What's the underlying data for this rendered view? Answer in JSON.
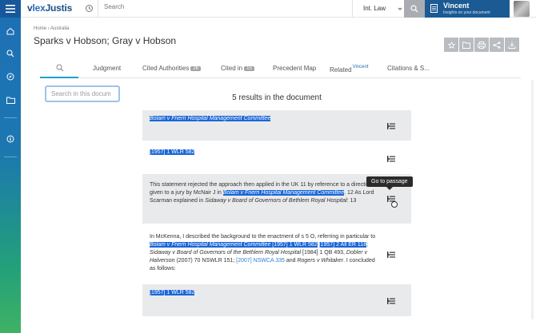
{
  "app": {
    "logo_v": "v",
    "logo_lex": "lex",
    "logo_rest": "Justis",
    "search_placeholder": "Search",
    "jurisdiction": "Int. Law",
    "user_name": "Vincent",
    "user_subtitle": "Insights on your document",
    "accent": "#1b5a93",
    "highlight_color": "#1a66d8"
  },
  "breadcrumb": "Home › Australia",
  "page_title": "Sparks v Hobson; Gray v Hobson",
  "tabs": [
    {
      "label": ""
    },
    {
      "label": "Judgment"
    },
    {
      "label": "Cited Authorities",
      "badge": "26"
    },
    {
      "label": "Cited in",
      "badge": "15"
    },
    {
      "label": "Precedent Map"
    },
    {
      "label": "Related",
      "sup": "Vincent"
    },
    {
      "label": "Citations & S..."
    }
  ],
  "doc_search": {
    "placeholder": "Search in this docum",
    "value": ""
  },
  "results_title": "5 results in the document",
  "results": {
    "r1": {
      "hl": "Bolam v Friern Hospital Management Committee"
    },
    "r2": {
      "hl": "[1957] 1 WLR 582"
    },
    "r3": {
      "t1": "This statement rejected the approach then applied in the UK 11 by reference to a direction given to a jury by McNair J in ",
      "hl": "Bolam v Friern Hospital Management Committee",
      "t2": ". 12 As Lord Scarman explained in ",
      "it1": "Sidaway v Board of Governors of Bethlem Royal Hospital",
      "t3": ": 13"
    },
    "r4": {
      "t1": "In McKenna, I described the background to the enactment of s 5 O, referring in particular to ",
      "hl1": "Bolam v Friern Hospital Management Committee",
      "hl2": " [1957] 1 WLR 582",
      "hl3": "[1957] 2 All ER 118",
      "t2": "; ",
      "it1": "Sidaway v Board of Governors of the Bethlem Royal Hospital",
      "t3": " [1984] 1 QB 493, ",
      "it2": "Dobler v Halverson",
      "t4": " (2007) 70 NSWLR 151; ",
      "lnk": "[2007] NSWCA 335",
      "t5": " and ",
      "it3": "Rogers v Whitaker",
      "t6": ". I concluded as follows:"
    },
    "r5": {
      "hl": "[1957] 1 WLR 582"
    }
  },
  "tooltip": "Go to passage"
}
